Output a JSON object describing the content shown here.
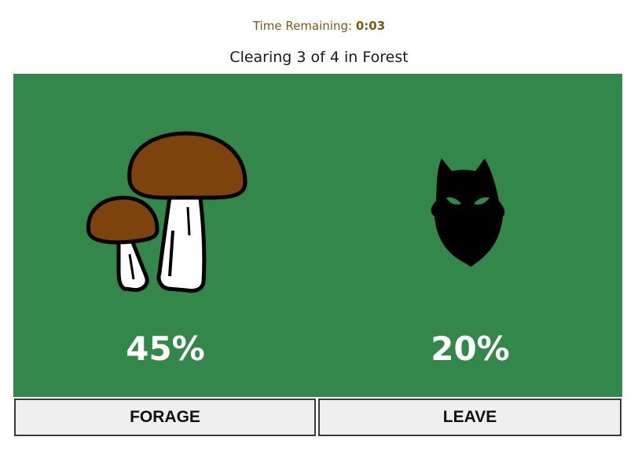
{
  "timer": {
    "label": "Time Remaining:",
    "value": "0:03"
  },
  "heading": "Clearing 3 of 4 in Forest",
  "options": {
    "forage": {
      "icon": "mushroom-icon",
      "percent": "45%",
      "button_label": "FORAGE"
    },
    "leave": {
      "icon": "wolf-icon",
      "percent": "20%",
      "button_label": "LEAVE"
    }
  },
  "colors": {
    "panel": "#33874b",
    "mushroom_cap": "#7e430c",
    "button_bg": "#efefef"
  }
}
